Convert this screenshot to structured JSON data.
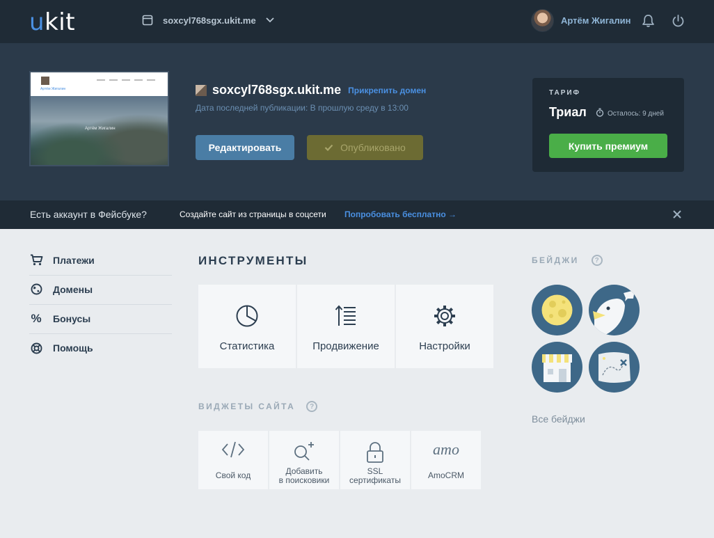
{
  "app": {
    "logo_u": "u",
    "logo_rest": "kit"
  },
  "header": {
    "site_selector": "soxcyl768sgx.ukit.me",
    "user_name": "Артём Жигалин"
  },
  "site": {
    "name": "soxcyl768sgx.ukit.me",
    "attach_domain": "Прикрепить домен",
    "last_published": "Дата последней публикации: В прошлую среду в 13:00",
    "edit_label": "Редактировать",
    "published_label": "Опубликовано",
    "thumb_name": "Артём Жигалин",
    "thumb_caption": "Артём Жигалин"
  },
  "tariff": {
    "label": "ТАРИФ",
    "name": "Триал",
    "remaining": "Осталось: 9 дней",
    "buy_label": "Купить премиум"
  },
  "fb_banner": {
    "question": "Есть аккаунт в Фейсбуке?",
    "description": "Создайте сайт из страницы в соцсети",
    "link": "Попробовать бесплатно →"
  },
  "sidebar": {
    "items": [
      {
        "label": "Платежи",
        "icon": "cart-icon"
      },
      {
        "label": "Домены",
        "icon": "globe-icon"
      },
      {
        "label": "Бонусы",
        "icon": "percent-icon"
      },
      {
        "label": "Помощь",
        "icon": "lifebuoy-icon"
      }
    ]
  },
  "tools": {
    "title": "ИНСТРУМЕНТЫ",
    "items": [
      {
        "label": "Статистика",
        "icon": "pie-chart-icon"
      },
      {
        "label": "Продвижение",
        "icon": "sort-list-icon"
      },
      {
        "label": "Настройки",
        "icon": "gear-icon"
      }
    ]
  },
  "widgets": {
    "title": "ВИДЖЕТЫ САЙТА",
    "help": "?",
    "items": [
      {
        "label": "Свой код",
        "icon": "code-icon"
      },
      {
        "label": "Добавить\nв поисковики",
        "icon": "search-plus-icon"
      },
      {
        "label": "SSL\nсертификаты",
        "icon": "lock-icon"
      },
      {
        "label": "AmoCRM",
        "icon": "amo-logo",
        "logo_text": "amo"
      }
    ]
  },
  "badges": {
    "title": "БЕЙДЖИ",
    "help": "?",
    "all_label": "Все бейджи",
    "items": [
      "moon-badge",
      "bird-badge",
      "shop-badge",
      "map-badge"
    ]
  },
  "colors": {
    "accent_blue": "#4a90e2",
    "topbar": "#1f2b36",
    "hero": "#2b3a4a",
    "premium_green": "#4aae48",
    "badge_bg": "#3e6888"
  }
}
